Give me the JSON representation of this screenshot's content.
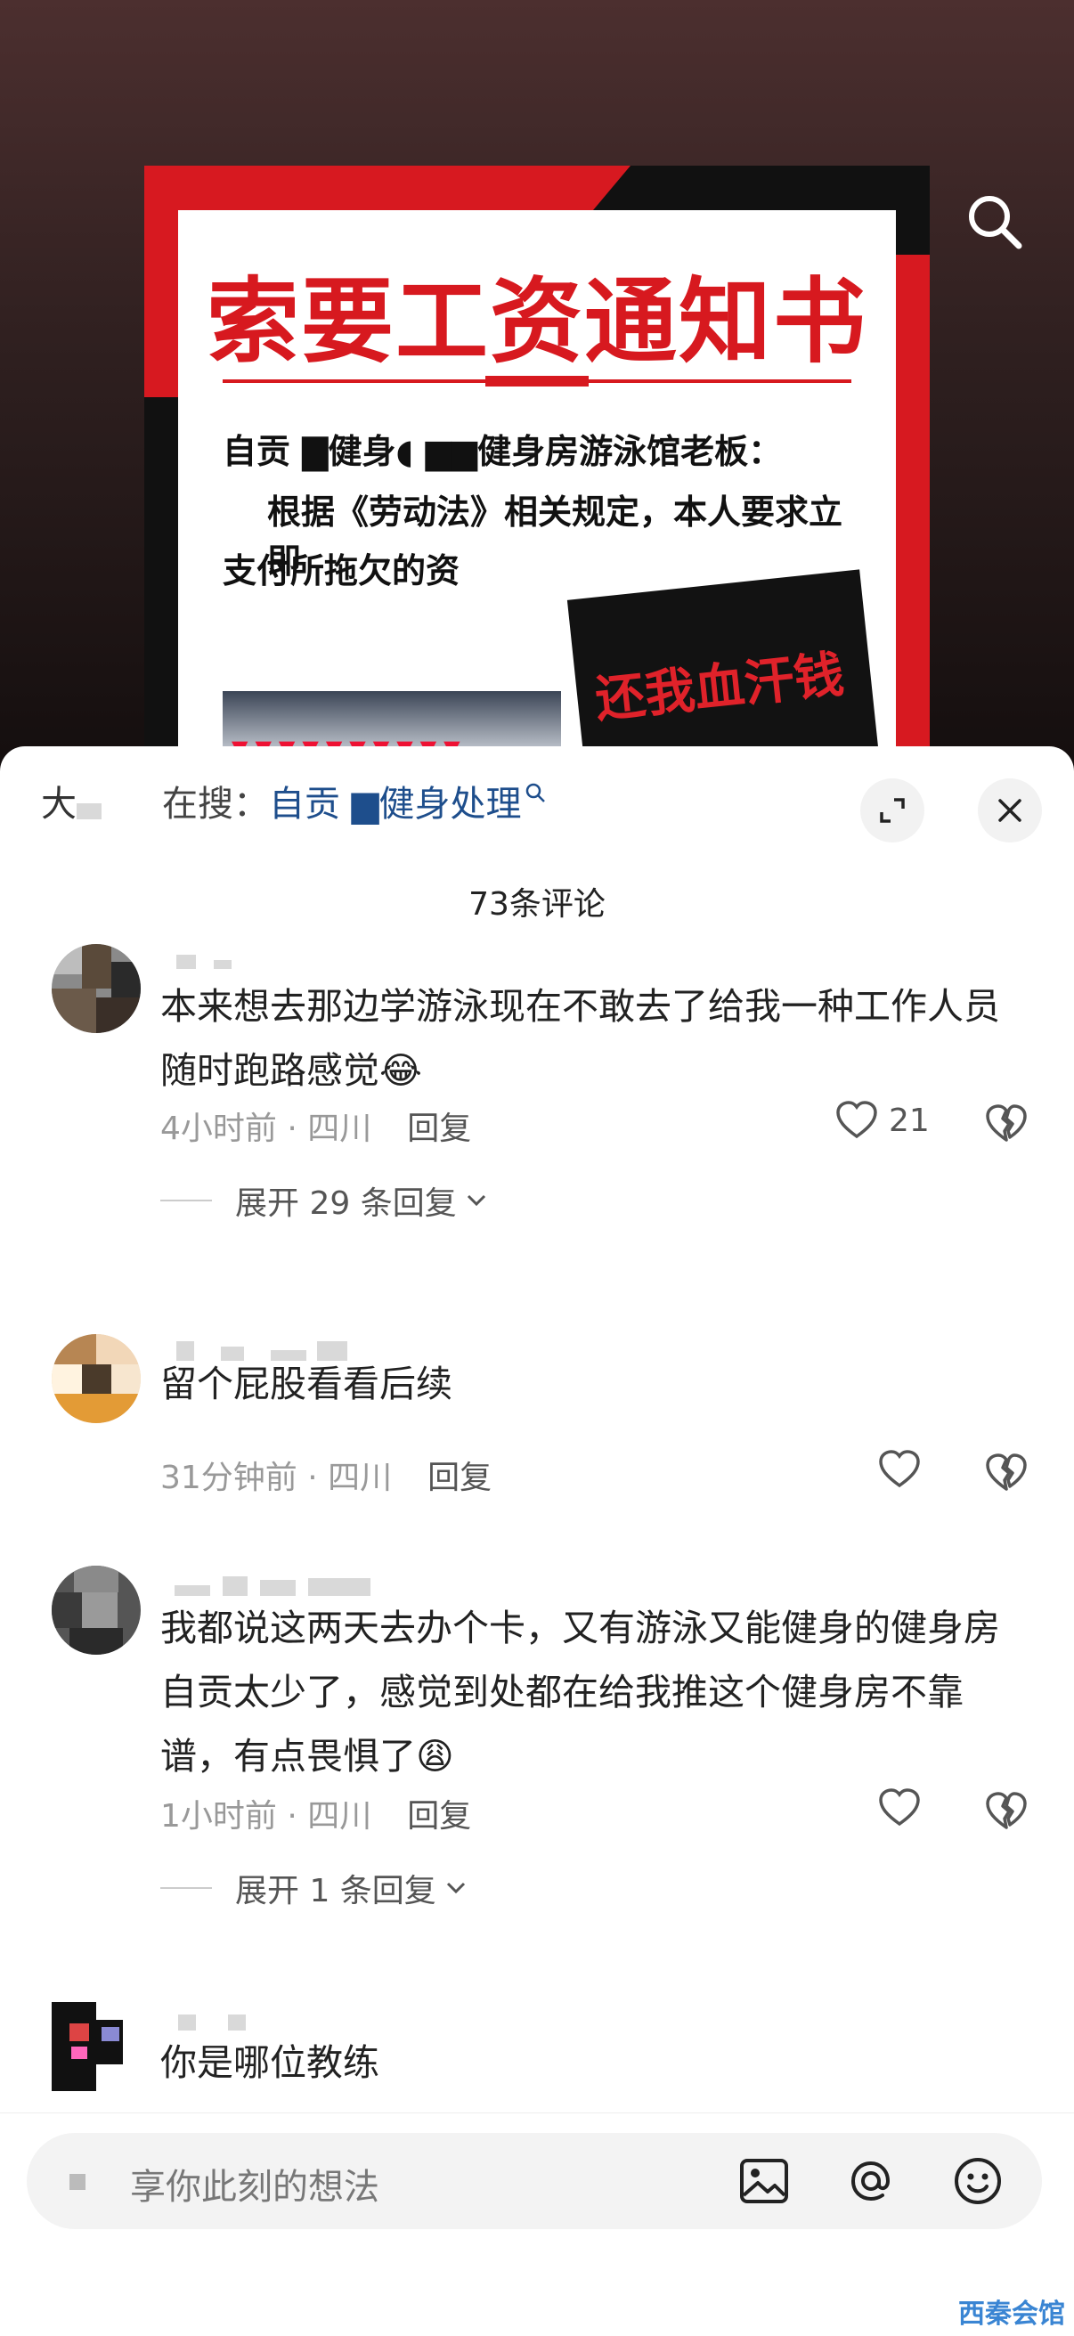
{
  "poster": {
    "title": "索要工资通知书",
    "line1": "自贡 ▇健身◖ ▆▆健身房游泳馆老板：",
    "line2": "根据《劳动法》相关规定，本人要求立即",
    "line3": "支付所拖欠的资",
    "sign": "还我血汗钱",
    "accent": "#d7191f"
  },
  "header": {
    "name": "大",
    "search_prefix": "在搜：",
    "search_keyword": "自贡 ▆健身处理",
    "comment_count": "73条评论"
  },
  "comments": [
    {
      "text": "本来想去那边学游泳现在不敢去了给我一种工作人员随时跑路感觉😂",
      "time": "4小时前 · 四川",
      "reply": "回复",
      "likes": "21",
      "expand": "展开 29 条回复"
    },
    {
      "text": "留个屁股看看后续",
      "time": "31分钟前 · 四川",
      "reply": "回复"
    },
    {
      "text": "我都说这两天去办个卡，又有游泳又能健身的健身房自贡太少了，感觉到处都在给我推这个健身房不靠谱，有点畏惧了😩",
      "time": "1小时前 · 四川",
      "reply": "回复",
      "expand": "展开 1 条回复"
    },
    {
      "text": "你是哪位教练"
    }
  ],
  "input": {
    "placeholder": "享你此刻的想法"
  },
  "icons": {
    "search": "search-icon",
    "expand": "fullscreen-icon",
    "close": "close-icon",
    "like": "heart-icon",
    "dislike": "broken-heart-icon",
    "image": "image-icon",
    "mention": "at-icon",
    "emoji": "emoji-icon"
  },
  "watermark": "西秦会馆"
}
